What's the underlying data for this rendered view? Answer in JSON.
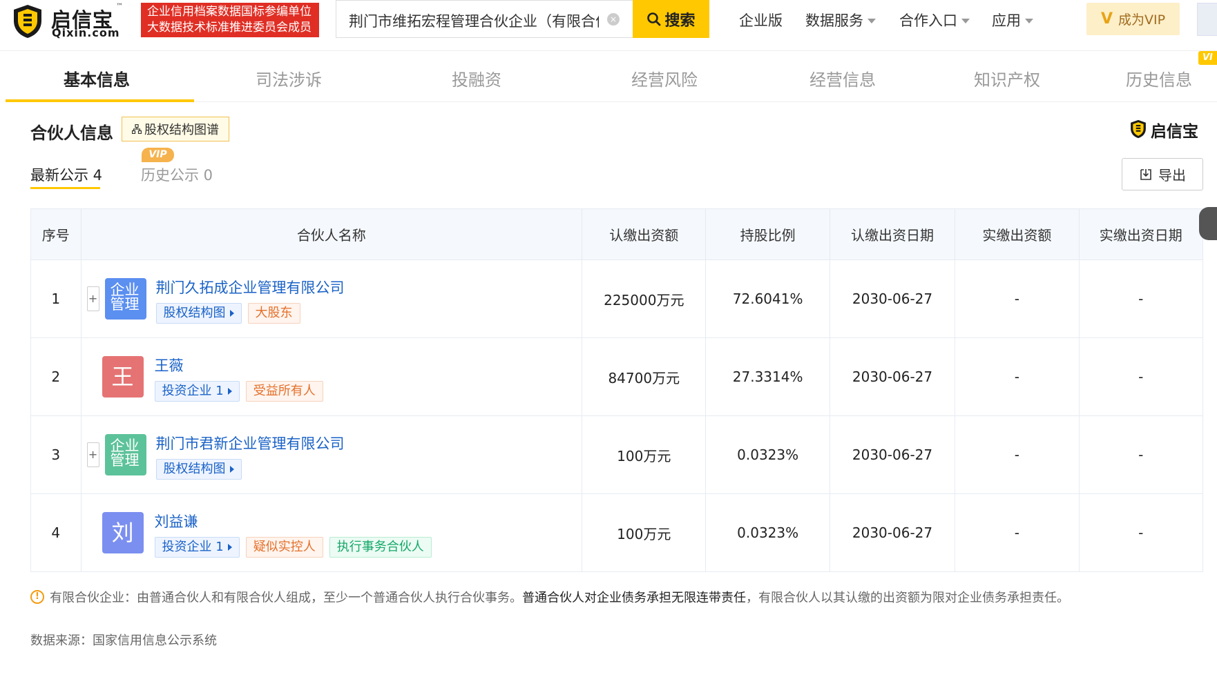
{
  "header": {
    "logo_cn": "启信宝",
    "logo_tm": "™",
    "logo_en": "Qixin.com",
    "banner_line1": "企业信用档案数据国标参编单位",
    "banner_line2": "大数据技术标准推进委员会成员",
    "search_value": "荆门市维拓宏程管理合伙企业（有限合伙）",
    "search_button": "搜索",
    "nav": [
      "企业版",
      "数据服务",
      "合作入口",
      "应用"
    ],
    "vip_button": "成为VIP",
    "vip_mark": "V",
    "clear_icon": "×"
  },
  "tabs": [
    "基本信息",
    "司法涉诉",
    "投融资",
    "经营风险",
    "经营信息",
    "知识产权",
    "历史信息"
  ],
  "tab_vip": "VI",
  "section": {
    "title": "合伙人信息",
    "equity_button": "股权结构图谱",
    "right_logo": "启信宝",
    "subtab_latest": "最新公示 4",
    "subtab_history": "历史公示 0",
    "vip_badge": "VIP",
    "export_button": "导出"
  },
  "table": {
    "headers": [
      "序号",
      "合伙人名称",
      "认缴出资额",
      "持股比例",
      "认缴出资日期",
      "实缴出资额",
      "实缴出资日期"
    ],
    "rows": [
      {
        "idx": "1",
        "type": "enterprise",
        "icon_text": "企业管理",
        "icon_color": "#5b8ff0",
        "name": "荆门久拓成企业管理有限公司",
        "tags": [
          {
            "text": "股权结构图",
            "style": "blue",
            "arrow": true
          },
          {
            "text": "大股东",
            "style": "orange"
          }
        ],
        "amount": "225000万元",
        "ratio": "72.6041%",
        "date": "2030-06-27",
        "paid": "-",
        "paid_date": "-"
      },
      {
        "idx": "2",
        "type": "person",
        "icon_text": "王",
        "icon_color": "#e57373",
        "name": "王薇",
        "tags": [
          {
            "text": "投资企业 1",
            "style": "blue",
            "arrow": true
          },
          {
            "text": "受益所有人",
            "style": "orange"
          }
        ],
        "amount": "84700万元",
        "ratio": "27.3314%",
        "date": "2030-06-27",
        "paid": "-",
        "paid_date": "-"
      },
      {
        "idx": "3",
        "type": "enterprise",
        "icon_text": "企业管理",
        "icon_color": "#5cc29a",
        "name": "荆门市君新企业管理有限公司",
        "tags": [
          {
            "text": "股权结构图",
            "style": "blue",
            "arrow": true
          }
        ],
        "amount": "100万元",
        "ratio": "0.0323%",
        "date": "2030-06-27",
        "paid": "-",
        "paid_date": "-"
      },
      {
        "idx": "4",
        "type": "person",
        "icon_text": "刘",
        "icon_color": "#7b8ff0",
        "name": "刘益谦",
        "tags": [
          {
            "text": "投资企业 1",
            "style": "blue",
            "arrow": true
          },
          {
            "text": "疑似实控人",
            "style": "orange"
          },
          {
            "text": "执行事务合伙人",
            "style": "green"
          }
        ],
        "amount": "100万元",
        "ratio": "0.0323%",
        "date": "2030-06-27",
        "paid": "-",
        "paid_date": "-"
      }
    ]
  },
  "note": {
    "part1": "有限合伙企业：由普通合伙人和有限合伙人组成，至少一个普通合伙人执行合伙事务。",
    "strong": "普通合伙人对企业债务承担无限连带责任",
    "part2": "，有限合伙人以其认缴的出资额为限对企业债务承担责任。"
  },
  "source": "数据来源：国家信用信息公示系统",
  "colors": {
    "accent": "#ffc800",
    "link": "#1a62c7",
    "banner": "#e02e24"
  }
}
